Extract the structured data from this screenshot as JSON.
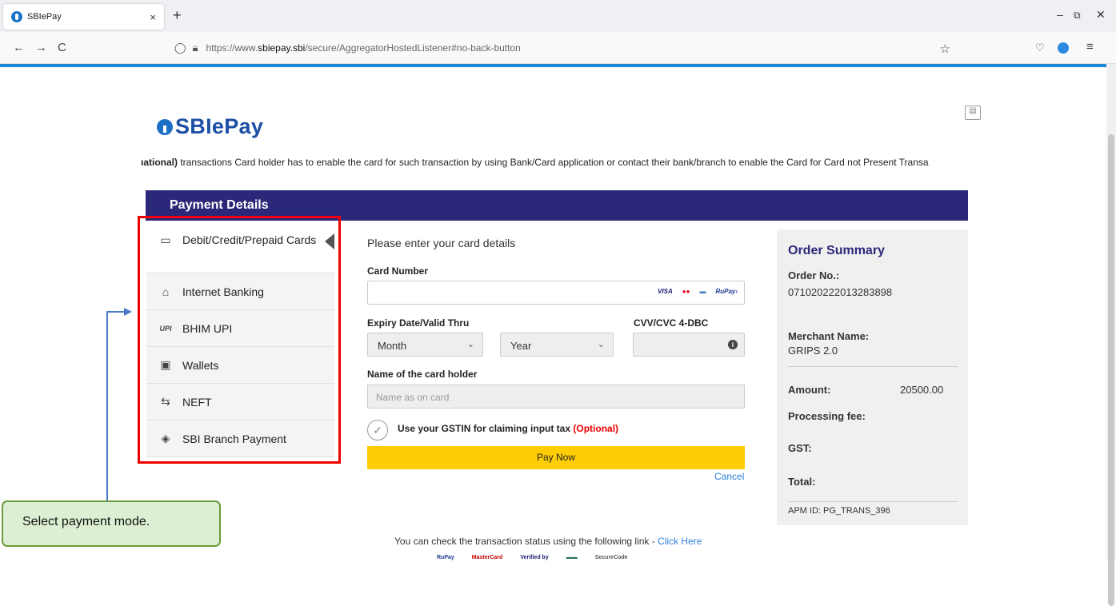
{
  "browser": {
    "tab_title": "SBIePay",
    "tab_close": "×",
    "new_tab": "+",
    "url_prefix": "https://www.",
    "url_domain": "sbiepay.sbi",
    "url_path": "/secure/AggregatorHostedListener#no-back-button",
    "back": "←",
    "forward": "→",
    "reload": "C",
    "star": "☆",
    "minimize": "–",
    "restore": "⧉",
    "close": "✕",
    "pocket": "♡",
    "menu": "≡"
  },
  "page": {
    "logo": "SBIePay",
    "marquee_bold": "ıational)",
    "marquee_text": " transactions Card holder has to enable the card for such transaction by using Bank/Card application or contact their bank/branch to enable the Card for Card not Present Transa",
    "payment_header": "Payment Details"
  },
  "sidebar": {
    "items": [
      {
        "label": "Debit/Credit/Prepaid Cards",
        "icon": "card-icon"
      },
      {
        "label": "Internet Banking",
        "icon": "bank-icon"
      },
      {
        "label": "BHIM UPI",
        "icon": "upi-icon"
      },
      {
        "label": "Wallets",
        "icon": "wallet-icon"
      },
      {
        "label": "NEFT",
        "icon": "transfer-icon"
      },
      {
        "label": "SBI Branch Payment",
        "icon": "cash-icon"
      }
    ]
  },
  "card_form": {
    "title": "Please enter your card details",
    "card_number_label": "Card Number",
    "card_logos": [
      "VISA",
      "●●",
      "▬",
      "RuPay›"
    ],
    "expiry_label": "Expiry Date/Valid Thru",
    "cvv_label": "CVV/CVC 4-DBC",
    "month_value": "Month",
    "year_value": "Year",
    "holder_label": "Name of the card holder",
    "holder_placeholder": "Name as on card",
    "gst_text": "Use your GSTIN for claiming input tax",
    "gst_optional": "(Optional)",
    "pay_button": "Pay Now",
    "cancel": "Cancel"
  },
  "summary": {
    "title": "Order Summary",
    "order_no_label": "Order No.:",
    "order_no": "071020222013283898",
    "merchant_label": "Merchant Name:",
    "merchant": "GRIPS 2.0",
    "amount_label": "Amount:",
    "amount": "20500.00",
    "fee_label": "Processing fee:",
    "gst_label": "GST:",
    "total_label": "Total:",
    "apm_id": "APM ID: PG_TRANS_396"
  },
  "callout": {
    "text": "Select payment mode."
  },
  "footer": {
    "text": "You can check the transaction status using the following link - ",
    "link": "Click Here",
    "logos": [
      "RuPay",
      "MasterCard",
      "Verified by",
      "▬▬",
      "SecureCode"
    ]
  },
  "colors": {
    "header_bg": "#2c2879",
    "pay_button": "#ffcd05",
    "highlight_box": "#ee0000",
    "callout_bg": "#dcefd2"
  }
}
